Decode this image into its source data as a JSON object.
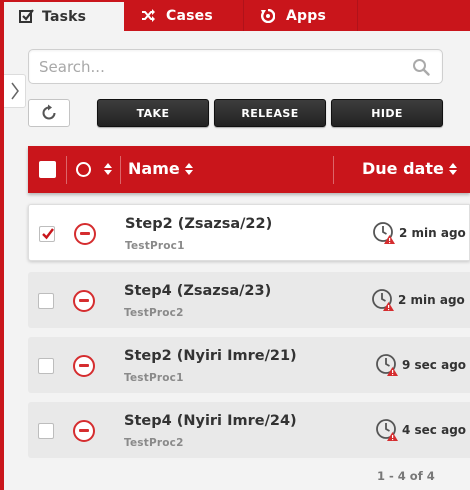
{
  "tabs": [
    {
      "label": "Tasks",
      "icon": "checkbox-icon",
      "active": true
    },
    {
      "label": "Cases",
      "icon": "shuffle-icon",
      "active": false
    },
    {
      "label": "Apps",
      "icon": "apps-icon",
      "active": false
    }
  ],
  "search": {
    "placeholder": "Search...",
    "value": ""
  },
  "toolbar": {
    "take_label": "TAKE",
    "release_label": "RELEASE",
    "hide_label": "HIDE"
  },
  "table": {
    "headers": {
      "name": "Name",
      "due": "Due date"
    },
    "rows": [
      {
        "title": "Step2 (Zsazsa/22)",
        "process": "TestProc1",
        "due": "2 min ago",
        "checked": true,
        "priority": "blocked"
      },
      {
        "title": "Step4 (Zsazsa/23)",
        "process": "TestProc2",
        "due": "2 min ago",
        "checked": false,
        "priority": "blocked"
      },
      {
        "title": "Step2 (Nyiri Imre/21)",
        "process": "TestProc1",
        "due": "9 sec ago",
        "checked": false,
        "priority": "blocked"
      },
      {
        "title": "Step4 (Nyiri Imre/24)",
        "process": "TestProc2",
        "due": "4 sec ago",
        "checked": false,
        "priority": "blocked"
      }
    ]
  },
  "pager": {
    "text": "1 - 4 of 4"
  },
  "colors": {
    "accent": "#c9151b",
    "priority": "#d52d2f",
    "dark_button": "#2b2b2b",
    "background": "#f3f3f3"
  }
}
